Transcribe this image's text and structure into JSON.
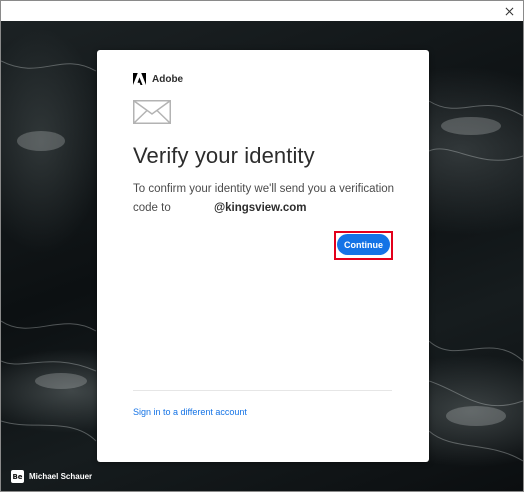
{
  "window": {
    "close_icon": "close-icon"
  },
  "background": {
    "credit_logo": "Be",
    "credit_name": "Michael Schauer"
  },
  "card": {
    "brand_name": "Adobe",
    "brand_logo_color": "#000000",
    "envelope_icon": "envelope-icon",
    "heading": "Verify your identity",
    "message": "To confirm your identity we'll send you a verification code to",
    "email_domain": "@kingsview.com",
    "continue_label": "Continue",
    "continue_color": "#1473e6",
    "highlight_color": "#e3001b",
    "alt_link": "Sign in to a different account"
  }
}
